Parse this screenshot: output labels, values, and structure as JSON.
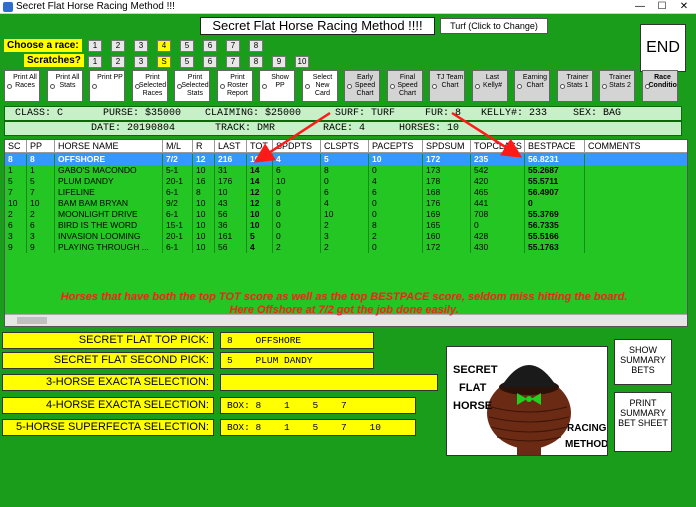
{
  "window": {
    "title": "Secret Flat Horse Racing Method !!!",
    "minimize": "—",
    "maximize": "☐",
    "close": "✕"
  },
  "header": {
    "title": "Secret Flat Horse Racing Method !!!!",
    "surface_button": "Turf (Click to Change)",
    "end_button": "END"
  },
  "race_selector": {
    "label": "Choose a race:",
    "options": [
      "1",
      "2",
      "3",
      "4",
      "5",
      "6",
      "7",
      "8"
    ],
    "selected": "4"
  },
  "scratches": {
    "label": "Scratches?",
    "options": [
      "1",
      "2",
      "3",
      "S",
      "5",
      "6",
      "7",
      "8",
      "9",
      "10"
    ]
  },
  "toolbar": [
    {
      "label": "Print All Races"
    },
    {
      "label": "Print All Stats"
    },
    {
      "label": "Print PP"
    },
    {
      "label": "Print Selected Races"
    },
    {
      "label": "Print Selected Stats"
    },
    {
      "label": "Print Roster Report"
    },
    {
      "label": "Show PP"
    },
    {
      "label": "Select New Card"
    },
    {
      "label": "Early Speed Chart"
    },
    {
      "label": "Final Speed Chart"
    },
    {
      "label": "TJ Team Chart"
    },
    {
      "label": "Last Kelly#"
    },
    {
      "label": "Earning Chart"
    },
    {
      "label": "Trainer Stats 1"
    },
    {
      "label": "Trainer Stats 2"
    },
    {
      "label": "Race Conditions"
    }
  ],
  "race_info": {
    "line1": {
      "class": "CLASS: C",
      "purse": "PURSE: $35000",
      "claiming": "CLAIMING: $25000",
      "surf": "SURF: TURF",
      "fur": "FUR: 8",
      "kelly": "KELLY#: 233",
      "sex": "SEX: BAG"
    },
    "line2": {
      "date": "DATE: 20190804",
      "track": "TRACK: DMR",
      "race": "RACE: 4",
      "horses": "HORSES: 10"
    }
  },
  "grid": {
    "columns": [
      "SC",
      "PP",
      "HORSE NAME",
      "M/L",
      "R",
      "LAST",
      "TOT",
      "SPDPTS",
      "CLSPTS",
      "PACEPTS",
      "SPDSUM",
      "TOPCLASS",
      "BESTPACE",
      "COMMENTS"
    ],
    "rows": [
      [
        "8",
        "8",
        "OFFSHORE",
        "7/2",
        "12",
        "216",
        "19",
        "4",
        "5",
        "10",
        "172",
        "235",
        "56.8231",
        ""
      ],
      [
        "1",
        "1",
        "GABO'S MACONDO",
        "5-1",
        "10",
        "31",
        "14",
        "6",
        "8",
        "0",
        "173",
        "542",
        "55.2687",
        ""
      ],
      [
        "5",
        "5",
        "PLUM DANDY",
        "20-1",
        "16",
        "176",
        "14",
        "10",
        "0",
        "4",
        "178",
        "420",
        "55.5711",
        ""
      ],
      [
        "7",
        "7",
        "LIFELINE",
        "6-1",
        "8",
        "10",
        "12",
        "0",
        "6",
        "6",
        "168",
        "465",
        "56.4907",
        ""
      ],
      [
        "10",
        "10",
        "BAM BAM BRYAN",
        "9/2",
        "10",
        "43",
        "12",
        "8",
        "4",
        "0",
        "176",
        "441",
        "0",
        ""
      ],
      [
        "2",
        "2",
        "MOONLIGHT DRIVE",
        "6-1",
        "10",
        "56",
        "10",
        "0",
        "10",
        "0",
        "169",
        "708",
        "55.3769",
        ""
      ],
      [
        "6",
        "6",
        "BIRD IS THE WORD",
        "15-1",
        "10",
        "36",
        "10",
        "0",
        "2",
        "8",
        "165",
        "0",
        "56.7335",
        ""
      ],
      [
        "3",
        "3",
        "INVASION LOOMING",
        "20-1",
        "10",
        "161",
        "5",
        "0",
        "3",
        "2",
        "160",
        "428",
        "55.5166",
        ""
      ],
      [
        "9",
        "9",
        "PLAYING THROUGH ...",
        "6-1",
        "10",
        "56",
        "4",
        "2",
        "2",
        "0",
        "172",
        "430",
        "55.1763",
        ""
      ]
    ]
  },
  "annotation": {
    "line1": "Horses that have both the top TOT score as well as the top BESTPACE score, seldom miss hitting the board.",
    "line2": "Here Offshore at 7/2 got the job done easily."
  },
  "picks": [
    {
      "label": "SECRET FLAT TOP PICK:",
      "value": "8    OFFSHORE"
    },
    {
      "label": "SECRET FLAT SECOND PICK:",
      "value": "5    PLUM DANDY"
    },
    {
      "label": "3-HORSE EXACTA SELECTION:",
      "value": ""
    },
    {
      "label": "4-HORSE EXACTA SELECTION:",
      "value": "BOX: 8    1    5    7"
    },
    {
      "label": "5-HORSE SUPERFECTA SELECTION:",
      "value": "BOX: 8    1    5    7    10"
    }
  ],
  "logo": {
    "line1": "SECRET",
    "line2": "FLAT",
    "line3": "HORSE",
    "line4": "RACING",
    "line5": "METHOD"
  },
  "side_buttons": {
    "show_summary": "SHOW SUMMARY BETS",
    "print_summary": "PRINT SUMMARY BET SHEET"
  },
  "colors": {
    "background": "#1a9d1a",
    "grid": "#24c624",
    "highlight": "#ffff00",
    "selected_row": "#3399ff",
    "annotation": "#ff1a1a"
  }
}
